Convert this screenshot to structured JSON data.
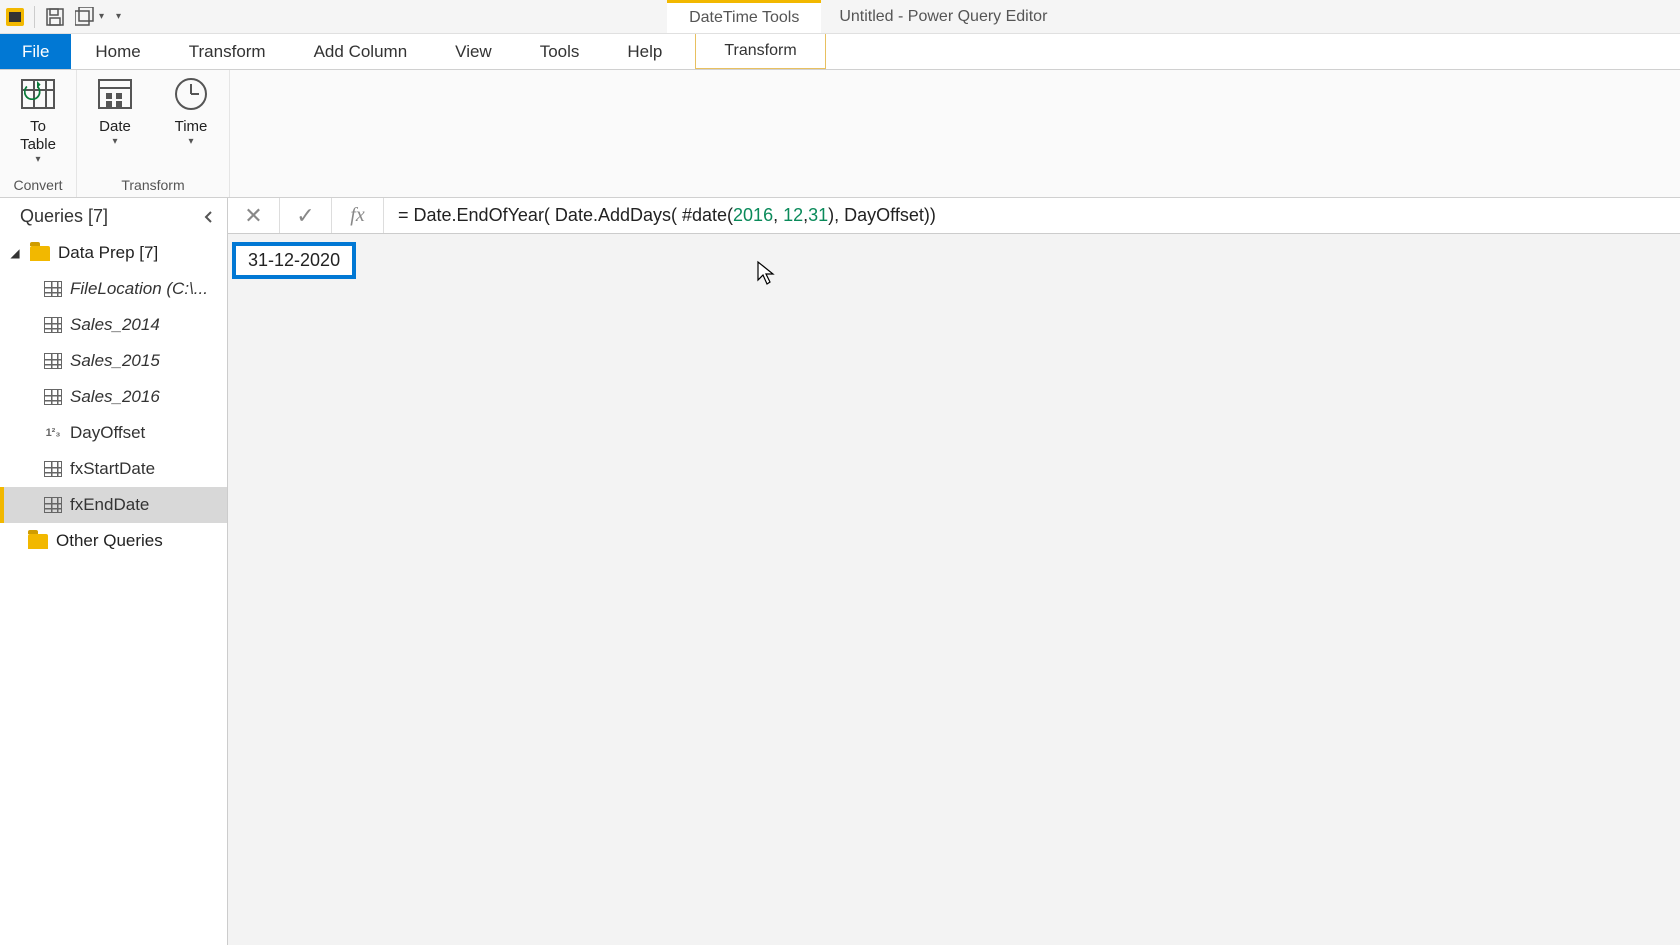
{
  "titlebar": {
    "context_tools": "DateTime Tools",
    "window_title": "Untitled - Power Query Editor"
  },
  "tabs": {
    "file": "File",
    "home": "Home",
    "transform": "Transform",
    "add_column": "Add Column",
    "view": "View",
    "tools": "Tools",
    "help": "Help",
    "context_transform": "Transform"
  },
  "ribbon": {
    "convert": {
      "to_table_line1": "To",
      "to_table_line2": "Table",
      "group_label": "Convert"
    },
    "transform": {
      "date": "Date",
      "time": "Time",
      "group_label": "Transform"
    }
  },
  "queries": {
    "header": "Queries [7]",
    "folder": "Data Prep [7]",
    "items": [
      {
        "label": "FileLocation (C:\\...",
        "kind": "table",
        "italic": true
      },
      {
        "label": "Sales_2014",
        "kind": "table",
        "italic": true
      },
      {
        "label": "Sales_2015",
        "kind": "table",
        "italic": true
      },
      {
        "label": "Sales_2016",
        "kind": "table",
        "italic": true
      },
      {
        "label": "DayOffset",
        "kind": "num",
        "italic": false
      },
      {
        "label": "fxStartDate",
        "kind": "table",
        "italic": false
      },
      {
        "label": "fxEndDate",
        "kind": "table",
        "italic": false,
        "selected": true
      }
    ],
    "other_folder": "Other Queries"
  },
  "formula": {
    "prefix": "= Date.EndOfYear( Date.AddDays( #date(",
    "n1": "2016",
    "c1": ", ",
    "n2": "12",
    "c2": ",",
    "n3": "31",
    "suffix": "), DayOffset))"
  },
  "result": "31-12-2020"
}
